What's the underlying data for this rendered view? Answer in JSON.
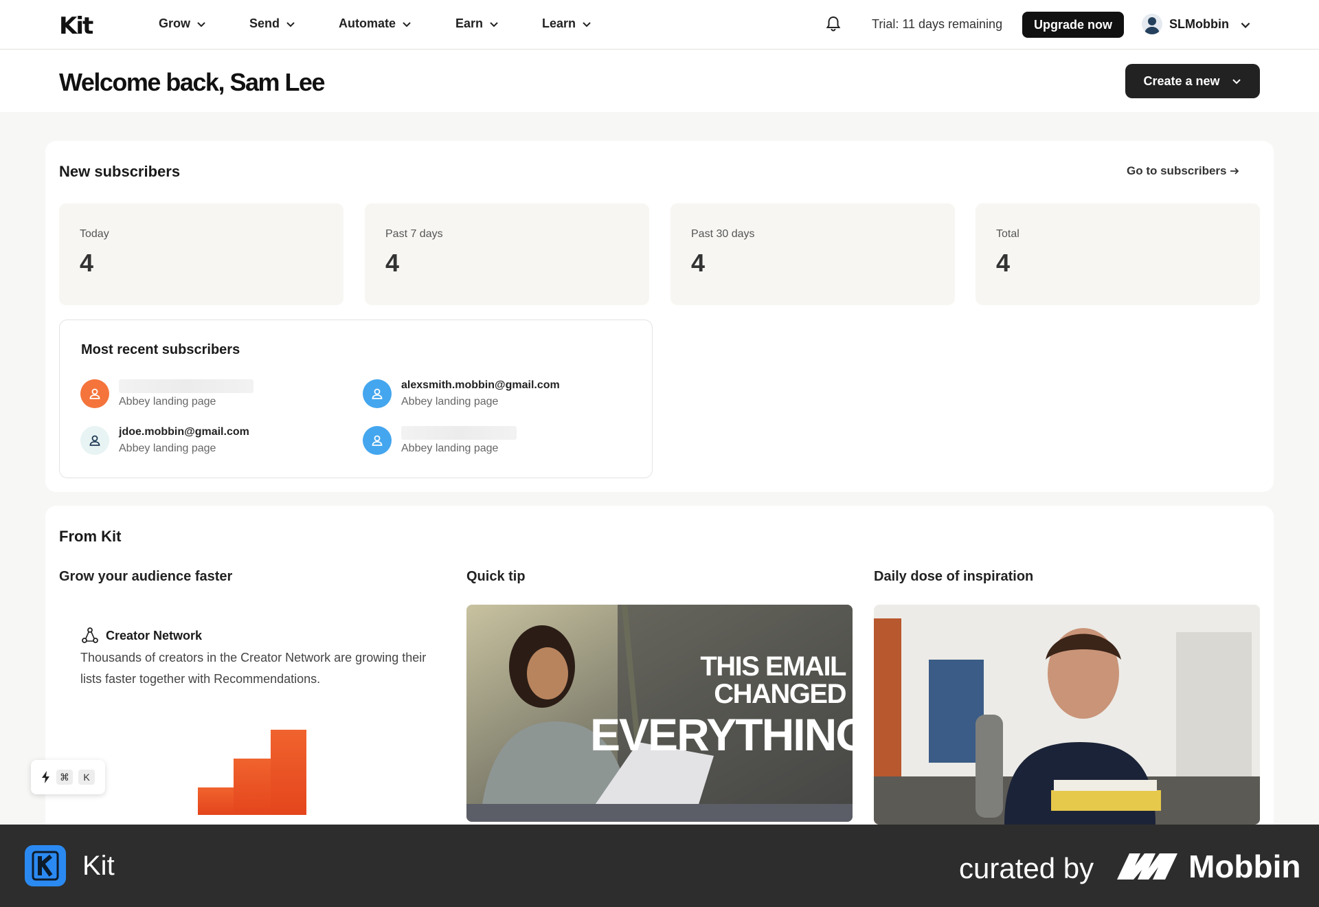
{
  "nav": {
    "logo": "Kit",
    "items": [
      {
        "label": "Grow"
      },
      {
        "label": "Send"
      },
      {
        "label": "Automate"
      },
      {
        "label": "Earn"
      },
      {
        "label": "Learn"
      }
    ],
    "trial": "Trial: 11 days remaining",
    "upgrade": "Upgrade now",
    "username": "SLMobbin"
  },
  "header": {
    "welcome": "Welcome back, Sam Lee",
    "create": "Create a new"
  },
  "subscribers": {
    "title": "New subscribers",
    "goto": "Go to subscribers",
    "stats": [
      {
        "label": "Today",
        "value": "4"
      },
      {
        "label": "Past 7 days",
        "value": "4"
      },
      {
        "label": "Past 30 days",
        "value": "4"
      },
      {
        "label": "Total",
        "value": "4"
      }
    ],
    "recent_title": "Most recent subscribers",
    "recent": [
      {
        "email": "",
        "source": "Abbey landing page"
      },
      {
        "email": "alexsmith.mobbin@gmail.com",
        "source": "Abbey landing page"
      },
      {
        "email": "jdoe.mobbin@gmail.com",
        "source": "Abbey landing page"
      },
      {
        "email": "",
        "source": "Abbey landing page"
      }
    ]
  },
  "from_kit": {
    "title": "From Kit",
    "col1_title": "Grow your audience faster",
    "col2_title": "Quick tip",
    "col3_title": "Daily dose of inspiration",
    "network_title": "Creator Network",
    "network_desc": "Thousands of creators in the Creator Network are growing their lists faster together with Recommendations.",
    "tip_line1": "THIS EMAIL CHANGED",
    "tip_line2": "EVERYTHING"
  },
  "shortcut": {
    "key1": "⌘",
    "key2": "K"
  },
  "footer": {
    "app_name": "Kit",
    "curated": "curated by",
    "brand": "Mobbin"
  }
}
